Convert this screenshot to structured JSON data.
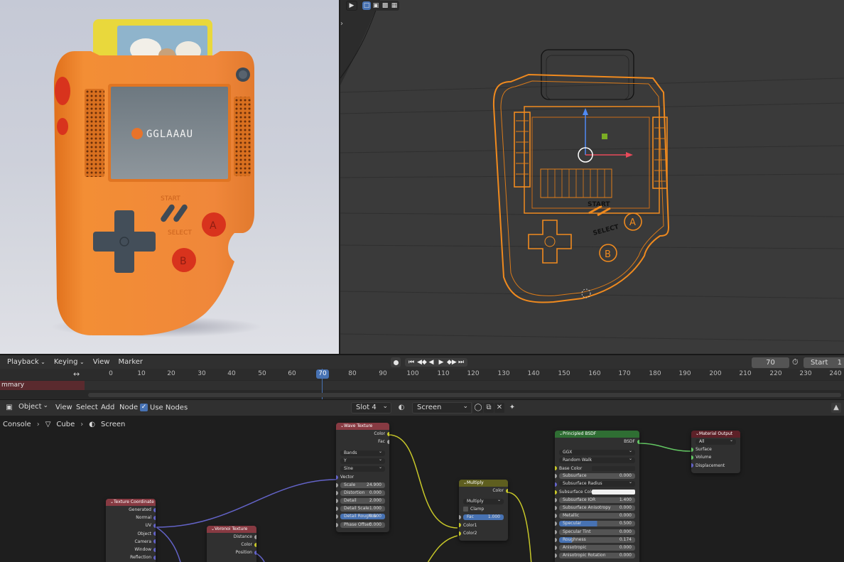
{
  "colors": {
    "accent": "#4772b3",
    "device_orange": "#f08a2e",
    "wire_yellow": "#c7c729",
    "wire_purple": "#6363c7",
    "wire_green": "#63c763",
    "node_header_texture": "#873a42",
    "node_header_multiply": "#5e5e1f",
    "node_header_shader": "#2f6e33",
    "node_header_output": "#5d2128"
  },
  "render": {
    "screen_text": "GGLAAAU",
    "start_label": "START",
    "select_label": "SELECT",
    "button_a": "A",
    "button_b": "B"
  },
  "viewport": {
    "start_label": "START",
    "select_label": "SELECT",
    "button_a": "A",
    "button_b": "B",
    "toolbar": {
      "select_icon": "cursor-icon",
      "box_select_icon": "box-select-icon"
    }
  },
  "timeline": {
    "menu": {
      "playback": "Playback",
      "keying": "Keying",
      "view": "View",
      "marker": "Marker"
    },
    "current_frame": "70",
    "start_label": "Start",
    "start_value": "1",
    "summary": "mmary",
    "ticks": [
      "0",
      "10",
      "20",
      "30",
      "40",
      "50",
      "60",
      "70",
      "80",
      "90",
      "100",
      "110",
      "120",
      "130",
      "140",
      "150",
      "160",
      "170",
      "180",
      "190",
      "200",
      "210",
      "220",
      "230",
      "240"
    ]
  },
  "node_editor": {
    "header": {
      "mode": "Object",
      "view": "View",
      "select": "Select",
      "add": "Add",
      "node": "Node",
      "use_nodes": "Use Nodes",
      "slot": "Slot 4",
      "material": "Screen"
    },
    "breadcrumb": {
      "console": "Console",
      "object": "Cube",
      "material": "Screen"
    },
    "nodes": {
      "wave": {
        "title": "Wave Texture",
        "out_color": "Color",
        "out_fac": "Fac",
        "type": "Bands",
        "direction": "Y",
        "profile": "Sine",
        "in_vector": "Vector",
        "scale_label": "Scale",
        "scale_value": "24.900",
        "distortion_label": "Distortion",
        "distortion_value": "0.000",
        "detail_label": "Detail",
        "detail_value": "2.000",
        "detail_scale_label": "Detail Scale",
        "detail_scale_value": "1.000",
        "detail_rough_label": "Detail Roughne",
        "detail_rough_value": "0.500",
        "phase_label": "Phase Offset",
        "phase_value": "0.000"
      },
      "texcoord": {
        "title": "Texture Coordinate",
        "outputs": [
          "Generated",
          "Normal",
          "UV",
          "Object",
          "Camera",
          "Window",
          "Reflection"
        ]
      },
      "voronoi": {
        "title": "Voronoi Texture",
        "outputs": [
          "Distance",
          "Color",
          "Position"
        ]
      },
      "multiply": {
        "title": "Multiply",
        "out_color": "Color",
        "blend": "Multiply",
        "clamp": "Clamp",
        "fac_label": "Fac",
        "fac_value": "1.000",
        "in_color1": "Color1",
        "in_color2": "Color2"
      },
      "principled": {
        "title": "Principled BSDF",
        "out_bsdf": "BSDF",
        "distribution": "GGX",
        "subsurface_method": "Random Walk",
        "base_color": "Base Color",
        "subsurface_label": "Subsurface",
        "subsurface_value": "0.000",
        "subsurface_radius": "Subsurface Radius",
        "subsurface_color": "Subsurface Color",
        "subsurface_ior_label": "Subsurface IOR",
        "subsurface_ior_value": "1.400",
        "subsurface_aniso_label": "Subsurface Anisotropy",
        "subsurface_aniso_value": "0.000",
        "metallic_label": "Metallic",
        "metallic_value": "0.000",
        "specular_label": "Specular",
        "specular_value": "0.500",
        "specular_tint_label": "Specular Tint",
        "specular_tint_value": "0.000",
        "roughness_label": "Roughness",
        "roughness_value": "0.174",
        "anisotropic_label": "Anisotropic",
        "anisotropic_value": "0.000",
        "anisotropic_rot_label": "Anisotropic Rotation",
        "anisotropic_rot_value": "0.000"
      },
      "output": {
        "title": "Material Output",
        "target": "All",
        "in_surface": "Surface",
        "in_volume": "Volume",
        "in_displacement": "Displacement"
      }
    }
  }
}
